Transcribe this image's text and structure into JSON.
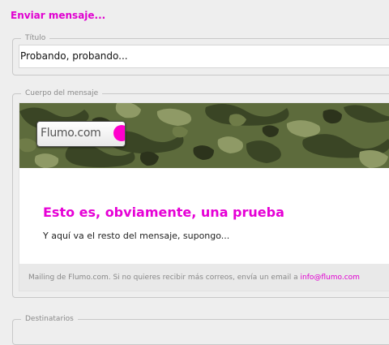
{
  "header": {
    "title": "Enviar mensaje..."
  },
  "title_field": {
    "legend": "Título",
    "value": "Probando, probando..."
  },
  "body_field": {
    "legend": "Cuerpo del mensaje",
    "logo_text": "Flumo.com",
    "headline": "Esto es, obviamente, una prueba",
    "text": "Y aquí va el resto del mensaje, supongo...",
    "footer_text": "Mailing de Flumo.com. Si no quieres recibir más correos, envía un email a ",
    "footer_link": "info@flumo.com"
  },
  "recipients_field": {
    "legend": "Destinatarios"
  },
  "colors": {
    "accent": "#e000d0",
    "camo_base": "#5d6b3c",
    "logo_shape": "#ff00cc"
  }
}
